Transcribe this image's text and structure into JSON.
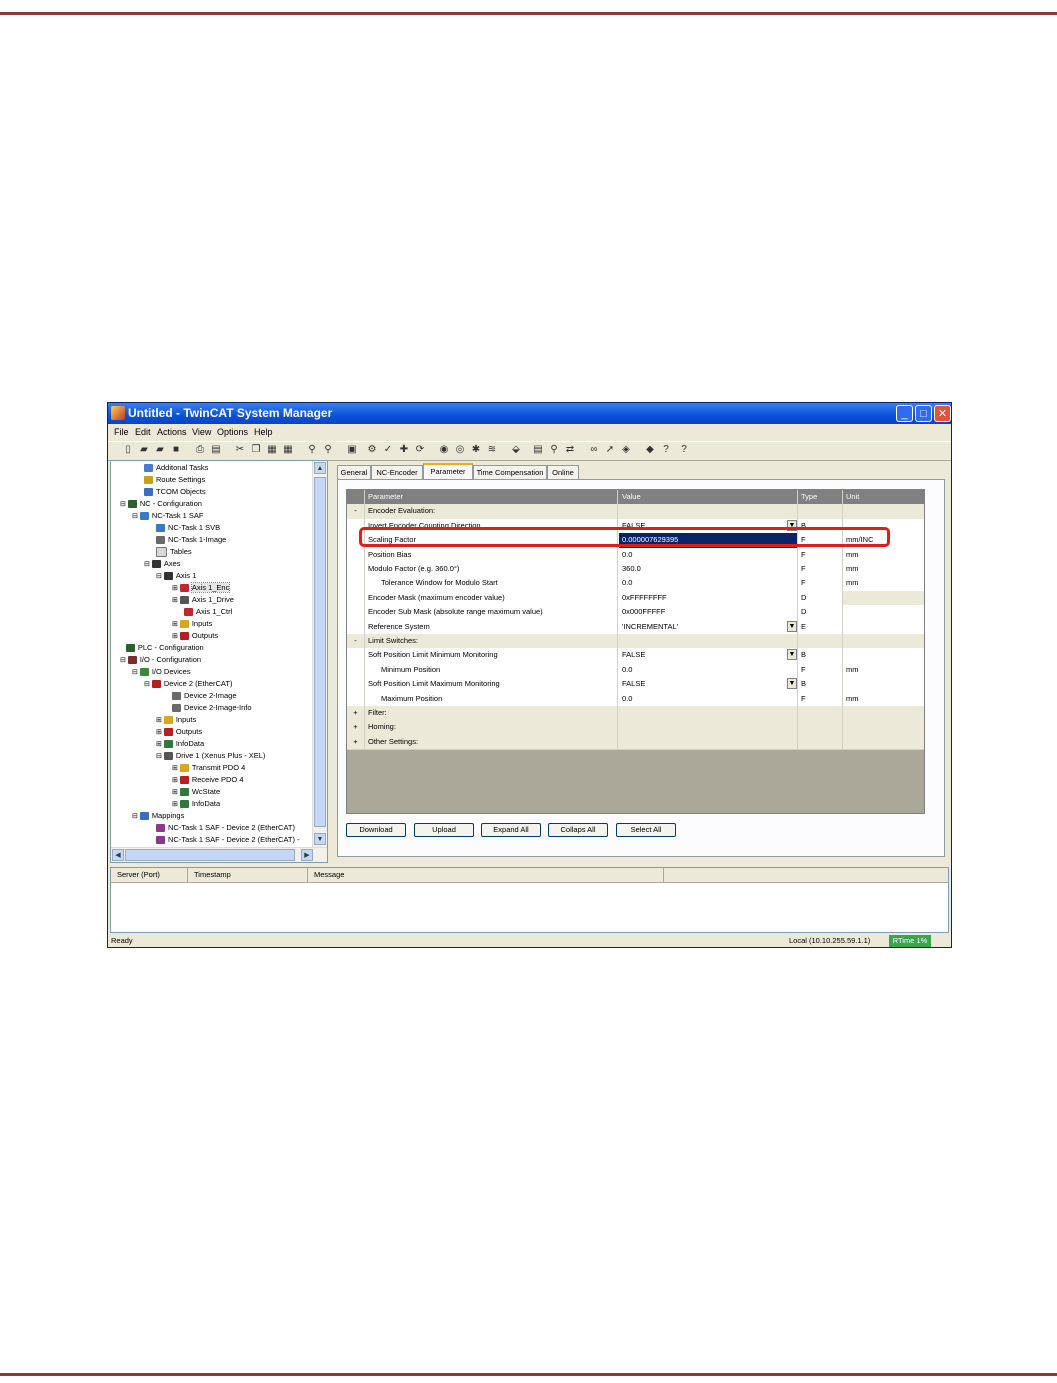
{
  "window": {
    "title": "Untitled - TwinCAT System Manager"
  },
  "menu": [
    "File",
    "Edit",
    "Actions",
    "View",
    "Options",
    "Help"
  ],
  "tree": [
    {
      "label": "Additonal Tasks",
      "icon": "tasks-icon"
    },
    {
      "label": "Route Settings",
      "icon": "route-icon"
    },
    {
      "label": "TCOM Objects",
      "icon": "tcom-icon"
    },
    {
      "label": "NC - Configuration",
      "icon": "nc-config-icon"
    },
    {
      "label": "NC-Task 1 SAF",
      "icon": "task-icon"
    },
    {
      "label": "NC-Task 1 SVB",
      "icon": "task-icon"
    },
    {
      "label": "NC-Task 1-Image",
      "icon": "image-icon"
    },
    {
      "label": "Tables",
      "icon": "table-icon"
    },
    {
      "label": "Axes",
      "icon": "axes-icon"
    },
    {
      "label": "Axis 1",
      "icon": "axis-icon"
    },
    {
      "label": "Axis 1_Enc",
      "icon": "encoder-icon"
    },
    {
      "label": "Axis 1_Drive",
      "icon": "drive-icon"
    },
    {
      "label": "Axis 1_Ctrl",
      "icon": "controller-icon"
    },
    {
      "label": "Inputs",
      "icon": "inputs-icon"
    },
    {
      "label": "Outputs",
      "icon": "outputs-icon"
    },
    {
      "label": "PLC - Configuration",
      "icon": "plc-icon"
    },
    {
      "label": "I/O - Configuration",
      "icon": "io-icon"
    },
    {
      "label": "I/O Devices",
      "icon": "devices-icon"
    },
    {
      "label": "Device 2 (EtherCAT)",
      "icon": "ethercat-icon"
    },
    {
      "label": "Device 2-Image",
      "icon": "image-icon"
    },
    {
      "label": "Device 2-Image-Info",
      "icon": "image-icon"
    },
    {
      "label": "Inputs",
      "icon": "inputs-icon"
    },
    {
      "label": "Outputs",
      "icon": "outputs-icon"
    },
    {
      "label": "InfoData",
      "icon": "infodata-icon"
    },
    {
      "label": "Drive 1 (Xenus Plus - XEL)",
      "icon": "drive-icon"
    },
    {
      "label": "Transmit PDO 4",
      "icon": "inputs-icon"
    },
    {
      "label": "Receive PDO 4",
      "icon": "outputs-icon"
    },
    {
      "label": "WcState",
      "icon": "infodata-icon"
    },
    {
      "label": "InfoData",
      "icon": "infodata-icon"
    },
    {
      "label": "Mappings",
      "icon": "mappings-icon"
    },
    {
      "label": "NC-Task 1 SAF - Device 2 (EtherCAT)",
      "icon": "mapping-icon"
    },
    {
      "label": "NC-Task 1 SAF - Device 2 (EtherCAT) -",
      "icon": "mapping-icon"
    }
  ],
  "tabs": [
    "General",
    "NC-Encoder",
    "Parameter",
    "Time Compensation",
    "Online"
  ],
  "table": {
    "headers": [
      "Parameter",
      "Value",
      "Type",
      "Unit"
    ],
    "rows": [
      {
        "kind": "group",
        "toggle": "-",
        "param": "Encoder Evaluation:",
        "value": "",
        "type": "",
        "unit": ""
      },
      {
        "kind": "data",
        "toggle": "",
        "param": "Invert Encoder Counting Direction",
        "value": "FALSE",
        "type": "B",
        "unit": "",
        "dropdown": true
      },
      {
        "kind": "data",
        "toggle": "",
        "param": "Scaling Factor",
        "value": "0.000007629395",
        "type": "F",
        "unit": "mm/INC",
        "selected": true
      },
      {
        "kind": "data",
        "toggle": "",
        "param": "Position Bias",
        "value": "0.0",
        "type": "F",
        "unit": "mm"
      },
      {
        "kind": "data",
        "toggle": "",
        "param": "Modulo Factor (e.g. 360.0°)",
        "value": "360.0",
        "type": "F",
        "unit": "mm"
      },
      {
        "kind": "data",
        "toggle": "",
        "param": "Tolerance Window for Modulo Start",
        "value": "0.0",
        "type": "F",
        "unit": "mm",
        "indent": true
      },
      {
        "kind": "data",
        "toggle": "",
        "param": "Encoder Mask (maximum encoder value)",
        "value": "0xFFFFFFFF",
        "type": "D",
        "unit": "",
        "grayunit": true
      },
      {
        "kind": "data",
        "toggle": "",
        "param": "Encoder Sub Mask (absolute range maximum value)",
        "value": "0x000FFFFF",
        "type": "D",
        "unit": ""
      },
      {
        "kind": "data",
        "toggle": "",
        "param": "Reference System",
        "value": "'INCREMENTAL'",
        "type": "E",
        "unit": "",
        "dropdown": true
      },
      {
        "kind": "group",
        "toggle": "-",
        "param": "Limit Switches:",
        "value": "",
        "type": "",
        "unit": ""
      },
      {
        "kind": "data",
        "toggle": "",
        "param": "Soft Position Limit Minimum Monitoring",
        "value": "FALSE",
        "type": "B",
        "unit": "",
        "dropdown": true
      },
      {
        "kind": "data",
        "toggle": "",
        "param": "Minimum Position",
        "value": "0.0",
        "type": "F",
        "unit": "mm",
        "indent": true
      },
      {
        "kind": "data",
        "toggle": "",
        "param": "Soft Position Limit Maximum Monitoring",
        "value": "FALSE",
        "type": "B",
        "unit": "",
        "dropdown": true
      },
      {
        "kind": "data",
        "toggle": "",
        "param": "Maximum Position",
        "value": "0.0",
        "type": "F",
        "unit": "mm",
        "indent": true
      },
      {
        "kind": "group",
        "toggle": "+",
        "param": "Filter:",
        "value": "",
        "type": "",
        "unit": ""
      },
      {
        "kind": "group",
        "toggle": "+",
        "param": "Homing:",
        "value": "",
        "type": "",
        "unit": ""
      },
      {
        "kind": "group",
        "toggle": "+",
        "param": "Other Settings:",
        "value": "",
        "type": "",
        "unit": ""
      }
    ]
  },
  "buttons": [
    "Download",
    "Upload",
    "Expand All",
    "Collaps All",
    "Select All"
  ],
  "log": {
    "columns": [
      "Server (Port)",
      "Timestamp",
      "Message"
    ]
  },
  "status": {
    "left": "Ready",
    "host": "Local (10.10.255.59.1.1)",
    "rtime": "RTime 1%"
  },
  "colors": {
    "title_bar": "#0a52d8",
    "selection": "#0a246a",
    "highlight_box": "#e51b1b",
    "page_rule": "#943634",
    "rtime_badge": "#3aa64c"
  }
}
